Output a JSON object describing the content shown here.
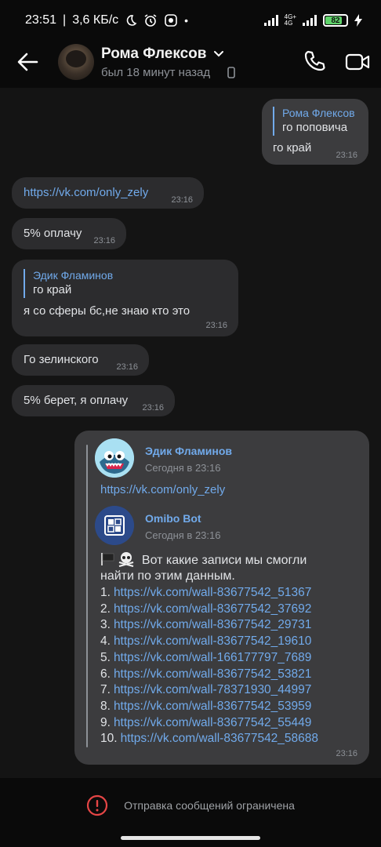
{
  "status_bar": {
    "time": "23:51",
    "speed": "3,6 КБ/с",
    "net_top": "4G+",
    "net_bottom": "4G",
    "battery": "82",
    "battery_level": 0.82
  },
  "header": {
    "name": "Рома Флексов",
    "status": "был 18 минут назад"
  },
  "messages": [
    {
      "dir": "out",
      "reply_author": "Рома Флексов",
      "reply_text": "го поповича",
      "text": "го край",
      "time": "23:16"
    },
    {
      "dir": "in",
      "text": "https://vk.com/only_zely",
      "time": "23:16",
      "is_link": true
    },
    {
      "dir": "in",
      "text": "5% оплачу",
      "time": "23:16"
    },
    {
      "dir": "in",
      "reply_author": "Эдик Фламинов",
      "reply_text": "го край",
      "text": "я со сферы бс,не знаю кто это",
      "time": "23:16"
    },
    {
      "dir": "in",
      "text": "Го зелинского",
      "time": "23:16"
    },
    {
      "dir": "in",
      "text": "5% берет, я оплачу",
      "time": "23:16"
    }
  ],
  "forwarded": {
    "author1": "Эдик Фламинов",
    "date1": "Сегодня в 23:16",
    "link1": "https://vk.com/only_zely",
    "author2": "Omibo Bot",
    "date2": "Сегодня в 23:16",
    "intro1": "Вот какие записи мы смогли",
    "intro2": "найти по этим данным.",
    "items": [
      {
        "num": "1.",
        "url": "https://vk.com/wall-83677542_51367"
      },
      {
        "num": "2.",
        "url": "https://vk.com/wall-83677542_37692"
      },
      {
        "num": "3.",
        "url": "https://vk.com/wall-83677542_29731"
      },
      {
        "num": "4.",
        "url": "https://vk.com/wall-83677542_19610"
      },
      {
        "num": "5.",
        "url": "https://vk.com/wall-166177797_7689"
      },
      {
        "num": "6.",
        "url": "https://vk.com/wall-83677542_53821"
      },
      {
        "num": "7.",
        "url": "https://vk.com/wall-78371930_44997"
      },
      {
        "num": "8.",
        "url": "https://vk.com/wall-83677542_53959"
      },
      {
        "num": "9.",
        "url": "https://vk.com/wall-83677542_55449"
      },
      {
        "num": "10.",
        "url": "https://vk.com/wall-83677542_58688"
      }
    ],
    "time": "23:16"
  },
  "footer": {
    "restriction": "Отправка сообщений ограничена"
  },
  "colors": {
    "accent": "#71aaeb",
    "bubble_in": "#2c2c2e",
    "bubble_out": "#3c3c3e",
    "warning": "#e64646"
  }
}
